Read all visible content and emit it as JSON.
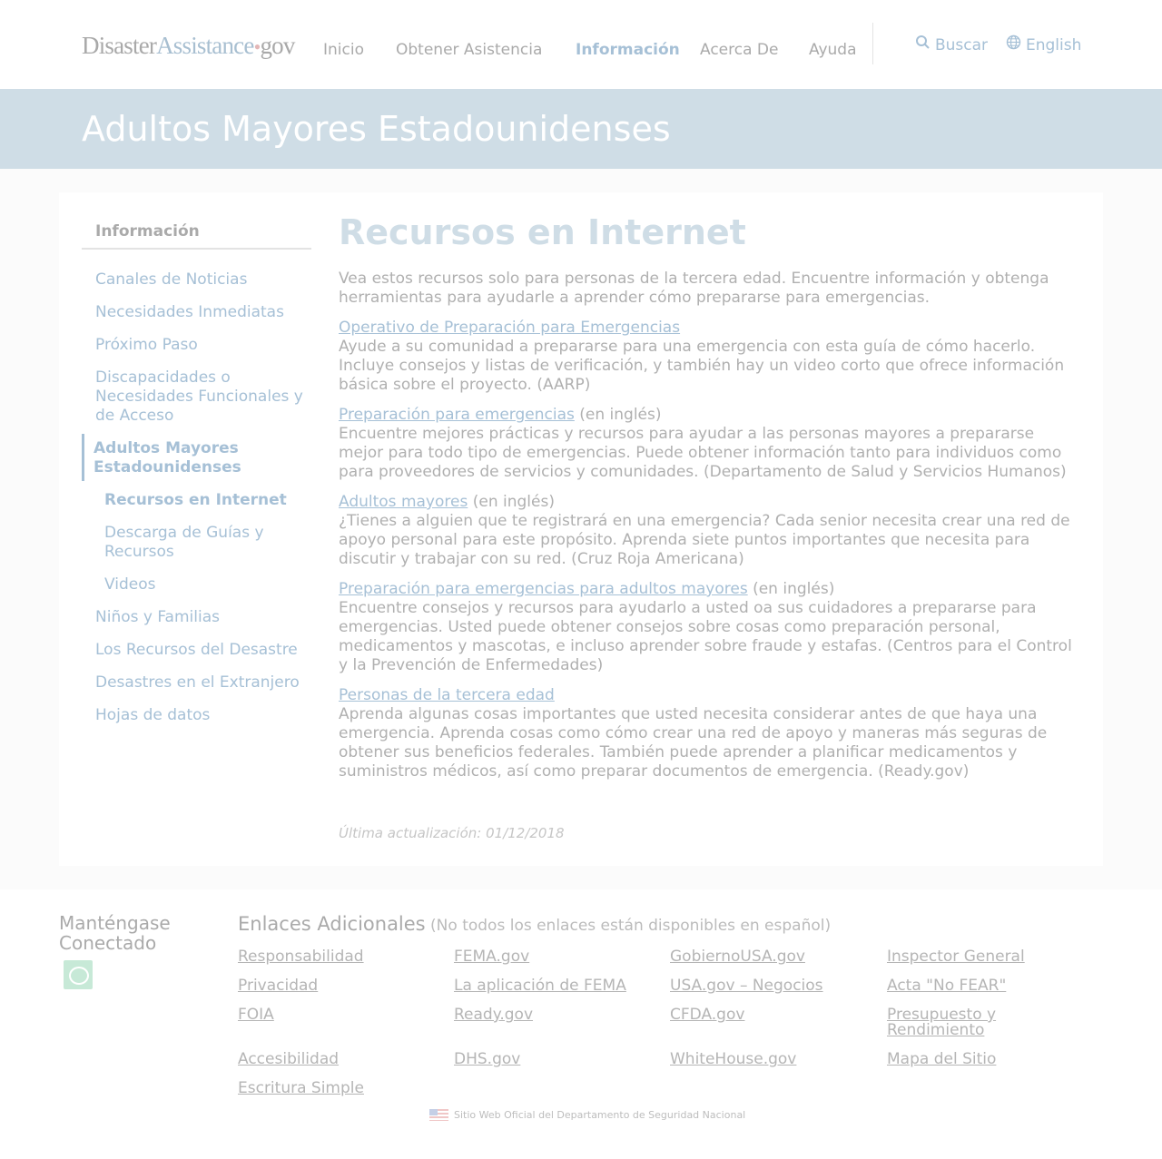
{
  "logo": {
    "part1": "Disaster",
    "part2": "Assistance",
    "dot": "•",
    "part3": "gov"
  },
  "nav": {
    "items": [
      {
        "label": "Inicio"
      },
      {
        "label": "Obtener Asistencia"
      },
      {
        "label": "Información",
        "active": true
      },
      {
        "label": "Acerca De"
      },
      {
        "label": "Ayuda"
      }
    ],
    "search_label": "Buscar",
    "search_icon": "search-icon",
    "language_label": "English",
    "language_icon": "globe-icon"
  },
  "banner": {
    "title": "Adultos Mayores Estadounidenses"
  },
  "sidebar": {
    "heading": "Información",
    "items": [
      {
        "label": "Canales de Noticias"
      },
      {
        "label": "Necesidades Inmediatas"
      },
      {
        "label": "Próximo Paso"
      },
      {
        "label": "Discapacidades o Necesidades Funcionales y de Acceso"
      },
      {
        "label": "Adultos Mayores Estadounidenses",
        "active": true
      },
      {
        "label": "Recursos en Internet",
        "sub": true,
        "current": true
      },
      {
        "label": "Descarga de Guías y Recursos",
        "sub": true
      },
      {
        "label": "Videos",
        "sub": true
      },
      {
        "label": "Niños y Familias"
      },
      {
        "label": "Los Recursos del Desastre"
      },
      {
        "label": "Desastres en el Extranjero"
      },
      {
        "label": "Hojas de datos"
      }
    ]
  },
  "content": {
    "title": "Recursos en Internet",
    "intro": "Vea estos recursos solo para personas de la tercera edad. Encuentre información y obtenga herramientas para ayudarle a aprender cómo prepararse para emergencias.",
    "resources": [
      {
        "link": "Operativo de Preparación para Emergencias",
        "note": "",
        "description": "Ayude a su comunidad a prepararse para una emergencia con esta guía de cómo hacerlo. Incluye consejos y listas de verificación, y también hay un video corto que ofrece información básica sobre el proyecto. (AARP)"
      },
      {
        "link": "Preparación para emergencias",
        "note": " (en inglés)",
        "description": "Encuentre mejores prácticas y recursos para ayudar a las personas mayores a prepararse mejor para todo tipo de emergencias. Puede obtener información tanto para individuos como para proveedores de servicios y comunidades. (Departamento de Salud y Servicios Humanos)"
      },
      {
        "link": "Adultos mayores",
        "note": " (en inglés)",
        "description": "¿Tienes a alguien que te registrará en una emergencia? Cada senior necesita crear una red de apoyo personal para este propósito. Aprenda siete puntos importantes que necesita para discutir y trabajar con su red. (Cruz Roja Americana)"
      },
      {
        "link": "Preparación para emergencias para adultos mayores",
        "note": " (en inglés)",
        "description": "Encuentre consejos y recursos para ayudarlo a usted oa sus cuidadores a prepararse para emergencias. Usted puede obtener consejos sobre cosas como preparación personal, medicamentos y mascotas, e incluso aprender sobre fraude y estafas. (Centros para el Control y la Prevención de Enfermedades)"
      },
      {
        "link": "Personas de la tercera edad",
        "note": "",
        "description": "Aprenda algunas cosas importantes que usted necesita considerar antes de que haya una emergencia. Aprenda cosas como cómo crear una red de apoyo y maneras más seguras de obtener sus beneficios federales. También puede aprender a planificar medicamentos y suministros médicos, así como preparar documentos de emergencia. (Ready.gov)"
      }
    ],
    "last_updated": "Última actualización: 01/12/2018"
  },
  "footer": {
    "stay_connected": "Manténgase Conectado",
    "social_icon": "chat-icon",
    "links_heading": "Enlaces Adicionales",
    "links_note": " (No todos los enlaces están disponibles en español)",
    "links": [
      "Responsabilidad",
      "FEMA.gov",
      "GobiernoUSA.gov",
      "Inspector General",
      "Privacidad",
      "La aplicación de FEMA",
      "USA.gov – Negocios",
      "Acta \"No FEAR\"",
      "FOIA",
      "Ready.gov",
      "CFDA.gov",
      "Presupuesto y Rendimiento",
      "Accesibilidad",
      "DHS.gov",
      "WhiteHouse.gov",
      "Mapa del Sitio",
      "Escritura Simple"
    ],
    "gov_notice": "Sitio Web Oficial del Departamento de Seguridad Nacional",
    "flag_icon": "us-flag-icon"
  }
}
